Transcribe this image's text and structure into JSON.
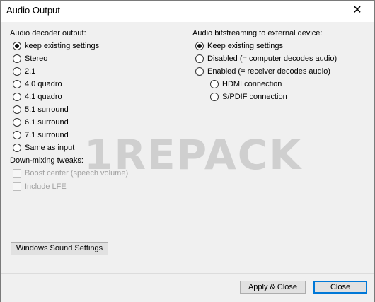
{
  "window": {
    "title": "Audio Output",
    "close_glyph": "✕"
  },
  "decoder": {
    "heading": "Audio decoder output:",
    "options": [
      {
        "label": "keep existing settings",
        "checked": true
      },
      {
        "label": "Stereo",
        "checked": false
      },
      {
        "label": "2.1",
        "checked": false
      },
      {
        "label": "4.0 quadro",
        "checked": false
      },
      {
        "label": "4.1 quadro",
        "checked": false
      },
      {
        "label": "5.1 surround",
        "checked": false
      },
      {
        "label": "6.1 surround",
        "checked": false
      },
      {
        "label": "7.1 surround",
        "checked": false
      },
      {
        "label": "Same as input",
        "checked": false
      }
    ]
  },
  "downmix": {
    "heading": "Down-mixing tweaks:",
    "boost_center": "Boost center (speech volume)",
    "include_lfe": "Include LFE"
  },
  "bitstream": {
    "heading": "Audio bitstreaming to external device:",
    "options": [
      {
        "label": "Keep existing settings",
        "checked": true
      },
      {
        "label": "Disabled (= computer decodes audio)",
        "checked": false
      },
      {
        "label": "Enabled  (= receiver decodes audio)",
        "checked": false
      }
    ],
    "sub_options": [
      {
        "label": "HDMI connection",
        "checked": false
      },
      {
        "label": "S/PDIF connection",
        "checked": false
      }
    ]
  },
  "buttons": {
    "windows_sound": "Windows Sound Settings",
    "apply_close": "Apply & Close",
    "close": "Close"
  },
  "watermark": "1REPACK"
}
